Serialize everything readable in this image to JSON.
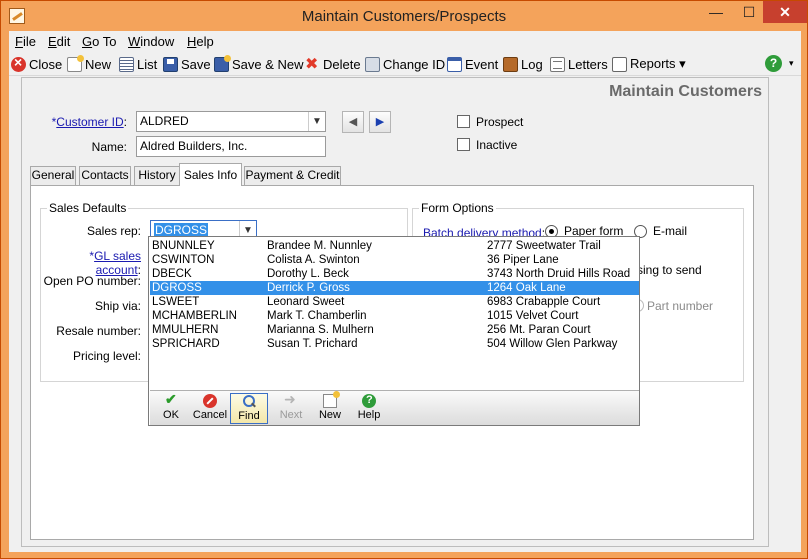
{
  "window": {
    "title": "Maintain Customers/Prospects",
    "min_glyph": "—",
    "max_glyph": "☐",
    "close_glyph": "✕"
  },
  "menu": [
    {
      "label": "File",
      "underline": "F",
      "rest": "ile"
    },
    {
      "label": "Edit",
      "underline": "E",
      "rest": "dit"
    },
    {
      "label": "Go To",
      "underline": "G",
      "rest": "o To"
    },
    {
      "label": "Window",
      "underline": "W",
      "rest": "indow"
    },
    {
      "label": "Help",
      "underline": "H",
      "rest": "elp"
    }
  ],
  "toolbar": {
    "close": "Close",
    "new": "New",
    "list": "List",
    "save": "Save",
    "save_new": "Save & New",
    "delete": "Delete",
    "change_id": "Change ID",
    "event": "Event",
    "log": "Log",
    "letters": "Letters",
    "reports": "Reports ▾",
    "help_glyph": "?",
    "overflow_glyph": "▾"
  },
  "header": {
    "title": "Maintain Customers"
  },
  "customer": {
    "id_label_prefix": "*",
    "id_label": "Customer ID",
    "id_label_suffix": ":",
    "id_value": "ALDRED",
    "name_label": "Name:",
    "name_value": "Aldred Builders, Inc.",
    "prev_glyph": "◀",
    "next_glyph": "▶"
  },
  "flags": {
    "prospect": "Prospect",
    "inactive": "Inactive"
  },
  "tabs": [
    "General",
    "Contacts",
    "History",
    "Sales Info",
    "Payment & Credit"
  ],
  "active_tab": "Sales Info",
  "sales_defaults": {
    "group_title": "Sales Defaults",
    "sales_rep_label": "Sales rep:",
    "sales_rep_value": "DGROSS",
    "gl_label_prefix": "*",
    "gl_label": "GL sales account",
    "gl_label_suffix": ":",
    "open_po_label": "Open PO number:",
    "ship_via_label": "Ship via:",
    "resale_label": "Resale number:",
    "pricing_label": "Pricing level:"
  },
  "form_options": {
    "group_title": "Form Options",
    "batch_label": "Batch delivery method",
    "batch_suffix": ":",
    "paper": "Paper form",
    "email": "E-mail",
    "partial_text": "ssing to send",
    "part_number": "Part number"
  },
  "lookup": {
    "rows": [
      {
        "id": "BNUNNLEY",
        "name": "Brandee M. Nunnley",
        "address": "2777 Sweetwater Trail"
      },
      {
        "id": "CSWINTON",
        "name": "Colista A. Swinton",
        "address": "36 Piper Lane"
      },
      {
        "id": "DBECK",
        "name": "Dorothy L. Beck",
        "address": "3743 North Druid Hills Road"
      },
      {
        "id": "DGROSS",
        "name": "Derrick P. Gross",
        "address": "1264 Oak Lane"
      },
      {
        "id": "LSWEET",
        "name": "Leonard Sweet",
        "address": "6983 Crabapple Court"
      },
      {
        "id": "MCHAMBERLIN",
        "name": "Mark T. Chamberlin",
        "address": "1015 Velvet Court"
      },
      {
        "id": "MMULHERN",
        "name": "Marianna S. Mulhern",
        "address": "256 Mt. Paran Court"
      },
      {
        "id": "SPRICHARD",
        "name": "Susan T. Prichard",
        "address": "504 Willow Glen Parkway"
      }
    ],
    "selected_id": "DGROSS",
    "buttons": {
      "ok": "OK",
      "cancel": "Cancel",
      "find": "Find",
      "next": "Next",
      "new": "New",
      "help": "Help"
    }
  }
}
